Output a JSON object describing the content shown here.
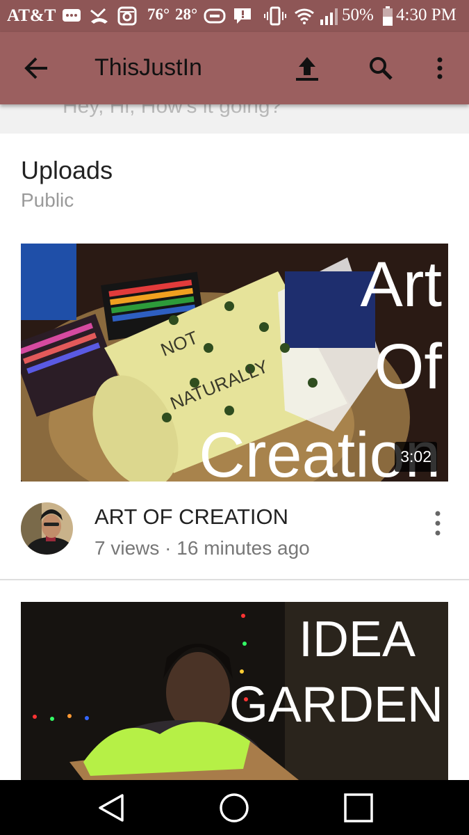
{
  "status_bar": {
    "carrier": "AT&T",
    "temp_1": "76°",
    "temp_2": "28°",
    "battery": "50%",
    "time": "4:30 PM",
    "icons": [
      "message-icon",
      "missed-call-icon",
      "instagram-icon",
      "gamepad-icon",
      "alert-message-icon",
      "vibrate-icon",
      "wifi-icon",
      "signal-icon",
      "battery-icon"
    ]
  },
  "app_bar": {
    "title": "ThisJustIn",
    "icons": [
      "back-arrow-icon",
      "upload-icon",
      "search-icon",
      "more-vert-icon"
    ]
  },
  "previous_card": {
    "text": "Hey, Hi, How's it going?"
  },
  "uploads": {
    "title": "Uploads",
    "subtitle": "Public",
    "videos": [
      {
        "title": "ART OF CREATION",
        "views": "7 views",
        "separator": "·",
        "age": "16 minutes ago",
        "duration": "3:02",
        "thumbnail_lines": [
          "Art",
          "Of",
          "Creation"
        ],
        "thumbnail_note_lines": [
          "NOT",
          "NATURALLY"
        ]
      },
      {
        "thumbnail_lines": [
          "IDEA",
          "GARDEN"
        ]
      }
    ]
  },
  "nav_bar": {
    "icons": [
      "back-triangle-icon",
      "home-circle-icon",
      "recents-square-icon"
    ]
  },
  "colors": {
    "status_bar": "#8e5656",
    "app_bar": "#9b5f5f"
  }
}
